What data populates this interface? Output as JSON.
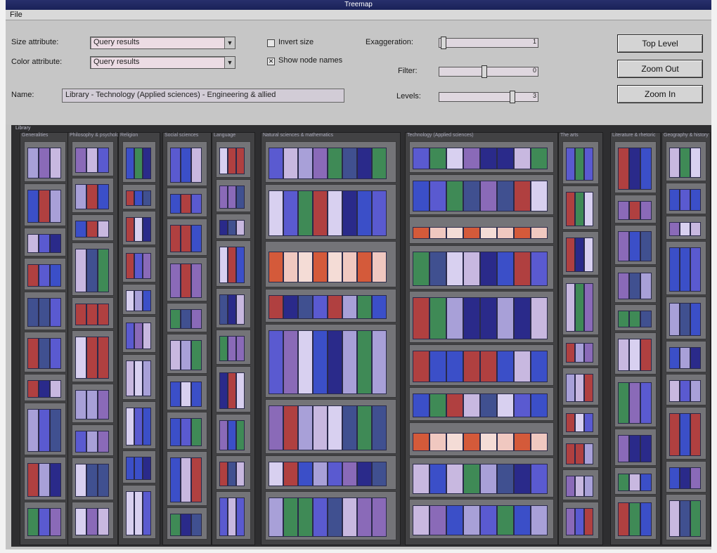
{
  "window": {
    "title": "Treemap"
  },
  "menu": {
    "file": "File"
  },
  "controls": {
    "size_attribute": {
      "label": "Size attribute:",
      "value": "Query results"
    },
    "color_attribute": {
      "label": "Color attribute:",
      "value": "Query results"
    },
    "invert_size": {
      "label": "Invert size",
      "checked": false
    },
    "show_node_names": {
      "label": "Show node names",
      "checked": true
    },
    "exaggeration": {
      "label": "Exaggeration:",
      "value": "1"
    },
    "filter": {
      "label": "Filter:",
      "value": "0"
    },
    "levels": {
      "label": "Levels:",
      "value": "3"
    },
    "name": {
      "label": "Name:",
      "value": "Library - Technology (Applied sciences) - Engineering & allied"
    }
  },
  "buttons": {
    "top_level": "Top Level",
    "zoom_out": "Zoom Out",
    "zoom_in": "Zoom In"
  },
  "treemap": {
    "root_label": "Library",
    "columns": [
      {
        "label": "Generalities"
      },
      {
        "label": "Philosophy & psychology"
      },
      {
        "label": "Religion"
      },
      {
        "label": "Social sciences"
      },
      {
        "label": "Language"
      },
      {
        "label": "Natural sciences & mathematics"
      },
      {
        "label": "Technology (Applied sciences)"
      },
      {
        "label": "The arts"
      },
      {
        "label": "Literature & rhetoric"
      },
      {
        "label": "Geography & history"
      }
    ],
    "colors": {
      "frame": "#2e2e30",
      "cell": "#747478",
      "accent_blue": "#3b4fc8",
      "accent_orange": "#d45a3a",
      "accent_pink": "#f0c8c0",
      "accent_lilac": "#a8a0d8"
    }
  }
}
